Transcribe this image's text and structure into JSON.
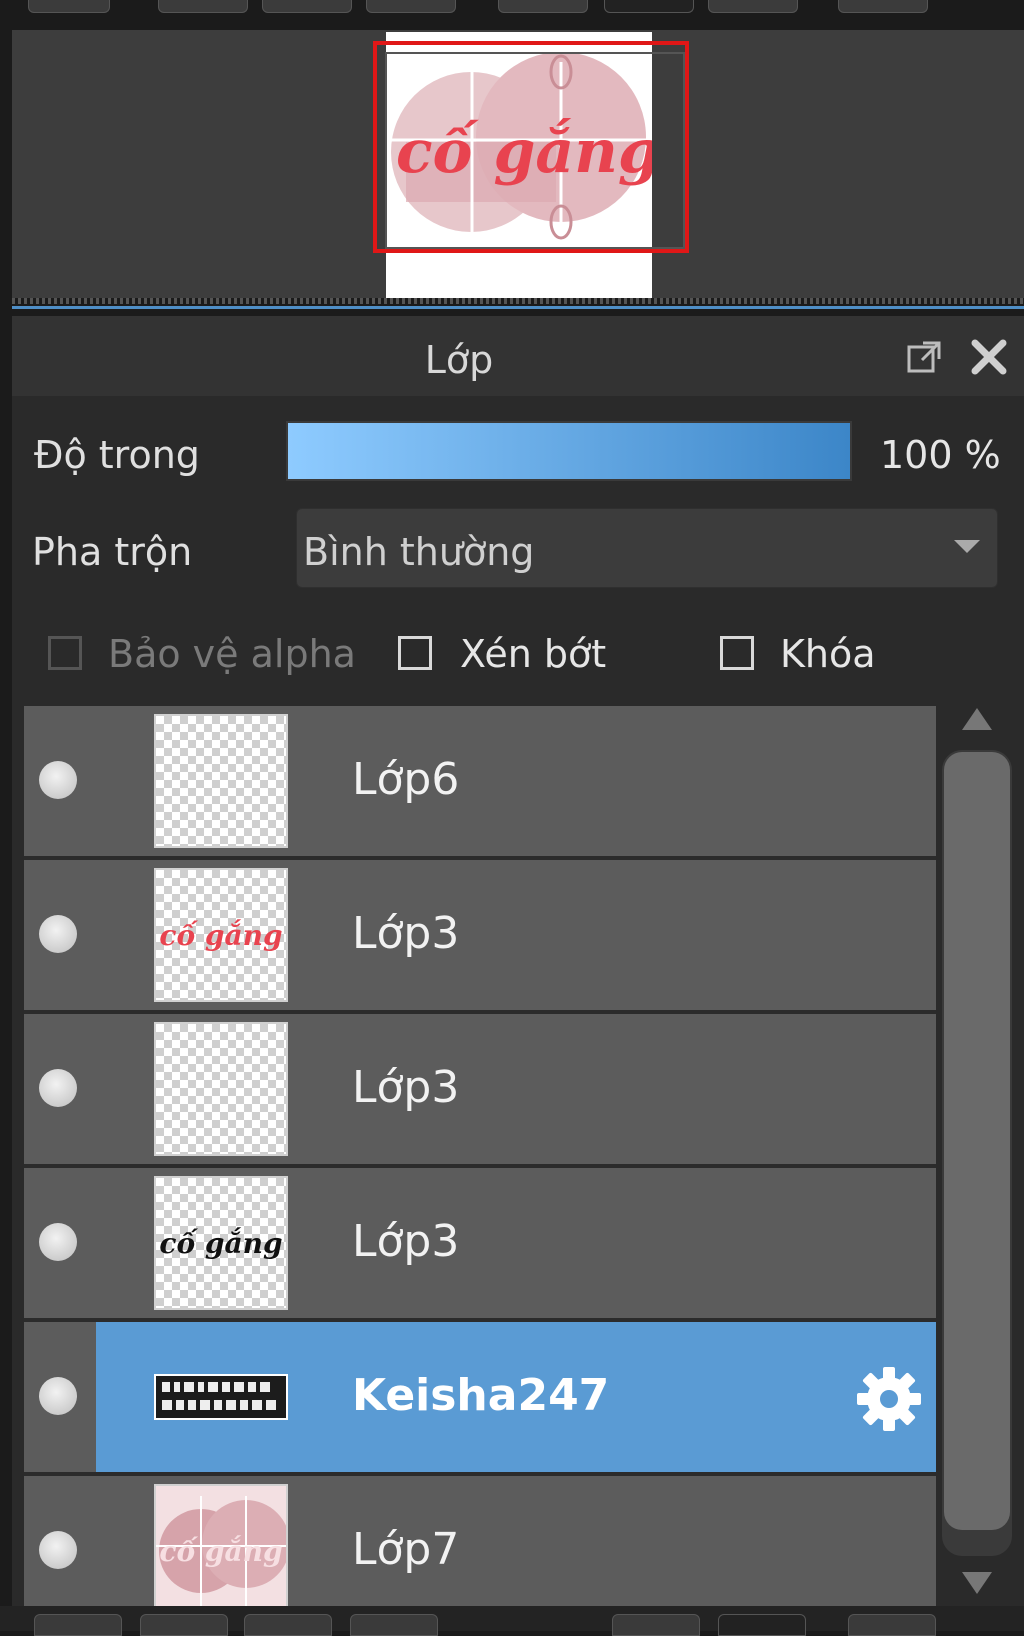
{
  "panel": {
    "title": "Lớp",
    "opacity_label": "Độ trong",
    "opacity_value": "100 %",
    "opacity_level": 1.0,
    "blend_label": "Pha trộn",
    "blend_value": "Bình thường",
    "protect_alpha_label": "Bảo vệ alpha",
    "clip_label": "Xén bớt",
    "lock_label": "Khóa",
    "protect_alpha_checked": false,
    "clip_checked": false,
    "lock_checked": false
  },
  "layers": [
    {
      "name": "Lớp6",
      "thumb": "",
      "selected": false
    },
    {
      "name": "Lớp3",
      "thumb": "cố gắng",
      "selected": false
    },
    {
      "name": "Lớp3",
      "thumb": "",
      "selected": false
    },
    {
      "name": "Lớp3",
      "thumb": "cố gắng",
      "selected": false
    },
    {
      "name": "Keisha247",
      "thumb": "",
      "selected": true
    },
    {
      "name": "Lớp7",
      "thumb": "cố gắng",
      "selected": false
    }
  ],
  "navigator": {
    "artwork_text": "cố gắng"
  },
  "colors": {
    "accent": "#5a9bd4",
    "viewport_frame": "#e01717",
    "artwork_text": "#e8434f"
  },
  "icons": {
    "popout": "popout-icon",
    "close": "close-icon",
    "settings": "gear-icon"
  }
}
